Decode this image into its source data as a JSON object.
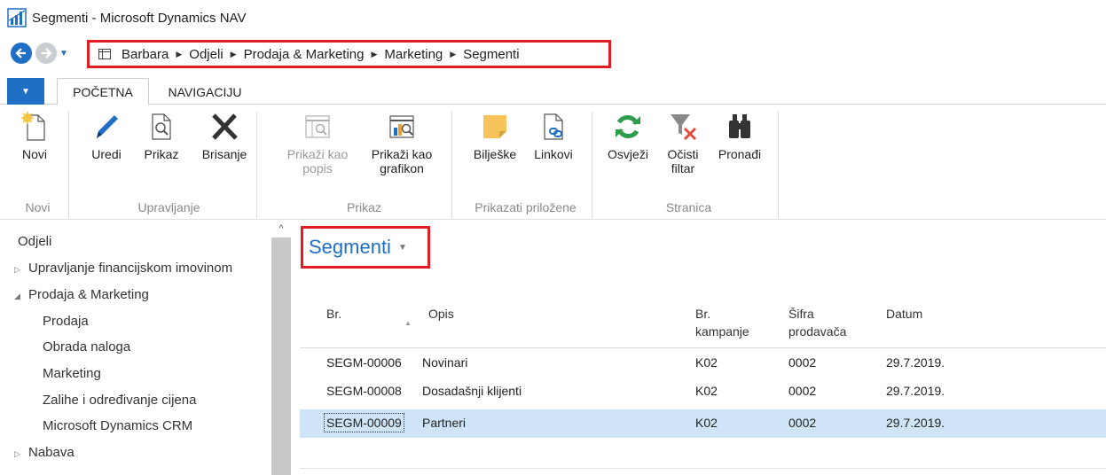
{
  "window": {
    "title": "Segmenti - Microsoft Dynamics NAV"
  },
  "breadcrumb": [
    "Barbara",
    "Odjeli",
    "Prodaja & Marketing",
    "Marketing",
    "Segmenti"
  ],
  "tabs": [
    {
      "label": "POČETNA"
    },
    {
      "label": "NAVIGACIJU"
    }
  ],
  "ribbon": {
    "groups": [
      {
        "label": "Novi",
        "buttons": [
          {
            "label": "Novi"
          }
        ]
      },
      {
        "label": "Upravljanje",
        "buttons": [
          {
            "label": "Uredi"
          },
          {
            "label": "Prikaz"
          },
          {
            "label": "Brisanje"
          }
        ]
      },
      {
        "label": "Prikaz",
        "buttons": [
          {
            "line1": "Prikaži kao",
            "line2": "popis"
          },
          {
            "line1": "Prikaži kao",
            "line2": "grafikon"
          }
        ]
      },
      {
        "label": "Prikazati priložene",
        "buttons": [
          {
            "label": "Bilješke"
          },
          {
            "label": "Linkovi"
          }
        ]
      },
      {
        "label": "Stranica",
        "buttons": [
          {
            "label": "Osvježi"
          },
          {
            "line1": "Očisti",
            "line2": "filtar"
          },
          {
            "label": "Pronađi"
          }
        ]
      }
    ]
  },
  "sidenav": {
    "items": [
      {
        "label": "Odjeli"
      },
      {
        "label": "Upravljanje financijskom imovinom"
      },
      {
        "label": "Prodaja & Marketing"
      },
      {
        "label": "Prodaja"
      },
      {
        "label": "Obrada naloga"
      },
      {
        "label": "Marketing"
      },
      {
        "label": "Zalihe i određivanje cijena"
      },
      {
        "label": "Microsoft Dynamics CRM"
      },
      {
        "label": "Nabava"
      }
    ]
  },
  "page": {
    "title": "Segmenti",
    "columns": {
      "br": "Br.",
      "opis": "Opis",
      "kampanja_1": "Br.",
      "kampanja_2": "kampanje",
      "prodavac_1": "Šifra",
      "prodavac_2": "prodavača",
      "datum": "Datum"
    },
    "rows": [
      {
        "br": "SEGM-00006",
        "opis": "Novinari",
        "kampanja": "K02",
        "prodavac": "0002",
        "datum": "29.7.2019."
      },
      {
        "br": "SEGM-00008",
        "opis": "Dosadašnji klijenti",
        "kampanja": "K02",
        "prodavac": "0002",
        "datum": "29.7.2019."
      },
      {
        "br": "SEGM-00009",
        "opis": "Partneri",
        "kampanja": "K02",
        "prodavac": "0002",
        "datum": "29.7.2019."
      }
    ]
  },
  "colors": {
    "accent": "#1f6fc5",
    "highlight": "#e31b23",
    "selected_row": "#cfe5f7"
  }
}
